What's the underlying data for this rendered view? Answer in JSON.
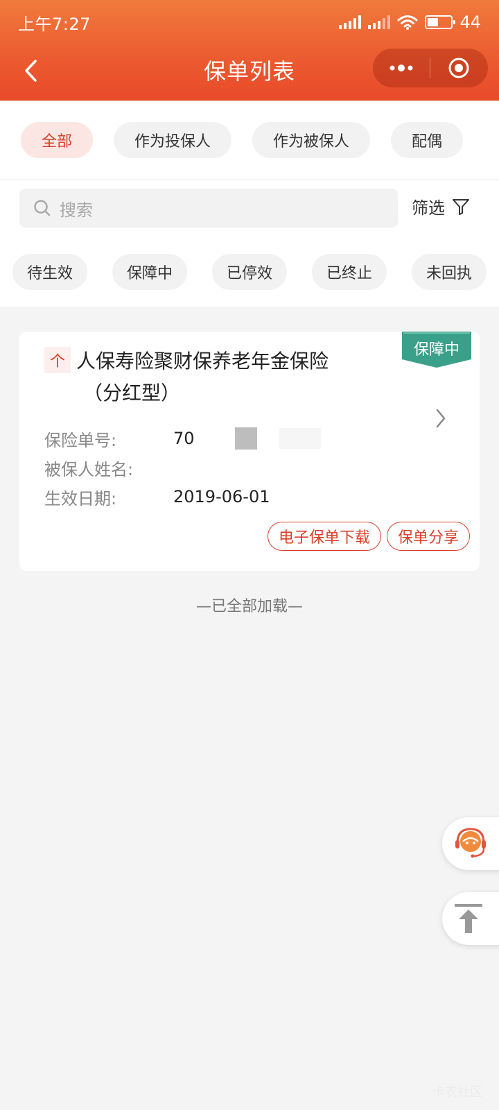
{
  "status_bar": {
    "time": "上午7:27",
    "battery": "44",
    "battery_level": 0.44
  },
  "nav": {
    "title": "保单列表"
  },
  "tabs": [
    {
      "label": "全部",
      "active": true
    },
    {
      "label": "作为投保人",
      "active": false
    },
    {
      "label": "作为被保人",
      "active": false
    },
    {
      "label": "配偶",
      "active": false
    }
  ],
  "search": {
    "placeholder": "搜索"
  },
  "filter": {
    "label": "筛选"
  },
  "status_chips": [
    "待生效",
    "保障中",
    "已停效",
    "已终止",
    "未回执"
  ],
  "policy": {
    "badge": "保障中",
    "type_tag": "个",
    "title_line1": "人保寿险聚财保养老年金保险",
    "title_line2": "（分红型）",
    "fields": [
      {
        "label": "保险单号:",
        "value": "70"
      },
      {
        "label": "被保人姓名:",
        "value": ""
      },
      {
        "label": "生效日期:",
        "value": "2019-06-01"
      }
    ],
    "actions": {
      "download": "电子保单下载",
      "share": "保单分享"
    }
  },
  "footer": {
    "loaded_text": "—已全部加载—"
  },
  "colors": {
    "primary": "#e8502d",
    "accent": "#d7402a",
    "badge": "#3aa08a"
  },
  "watermark": "卡农社区"
}
